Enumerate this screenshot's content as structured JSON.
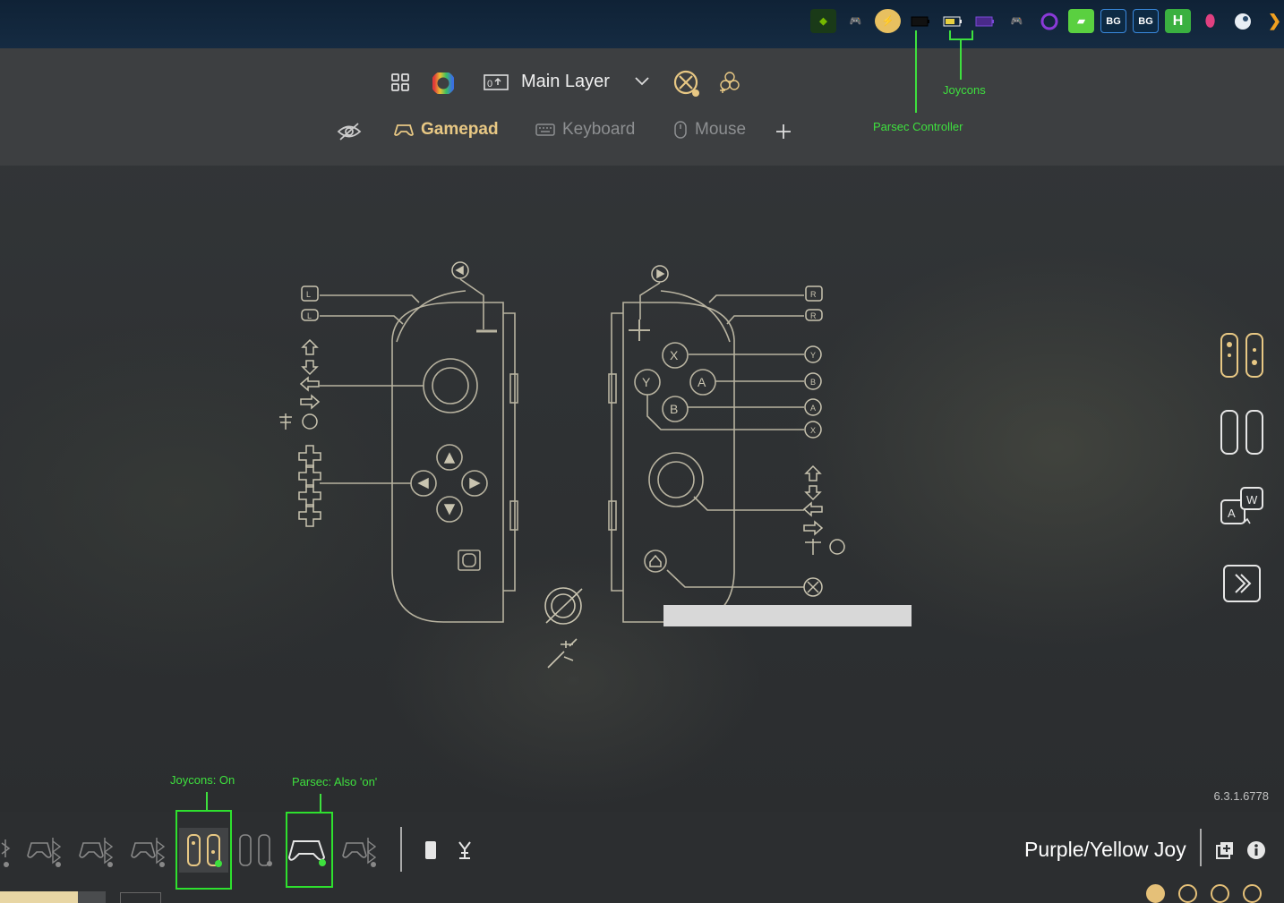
{
  "header": {
    "layer_label": "Main Layer"
  },
  "tabs": [
    {
      "label": "Gamepad",
      "icon": "gamepad-icon",
      "active": true
    },
    {
      "label": "Keyboard",
      "icon": "keyboard-icon",
      "active": false
    },
    {
      "label": "Mouse",
      "icon": "mouse-icon",
      "active": false
    }
  ],
  "annotations": {
    "joycons": "Joycons",
    "parsec_controller": "Parsec Controller",
    "joycons_on": "Joycons: On",
    "parsec_on": "Parsec: Also 'on'"
  },
  "joycon_map": {
    "face_buttons": [
      "X",
      "Y",
      "A",
      "B"
    ],
    "left_shoulder": [
      "L",
      "L"
    ],
    "right_shoulder": [
      "R",
      "R"
    ],
    "mapped_right": [
      "Y",
      "B",
      "A",
      "X"
    ]
  },
  "footer": {
    "version": "6.3.1.6778",
    "profile_name": "Purple/Yellow Joy"
  },
  "tray_icons": [
    "nvidia-icon",
    "gamepad-icon",
    "lightning-icon",
    "battery-icon",
    "battery-yellow-icon",
    "battery-purple-icon",
    "gamepad-icon",
    "ring-icon",
    "green-app-icon",
    "bg-icon",
    "bg-icon",
    "h-icon",
    "shield-icon",
    "steam-icon",
    "chevron-right-icon"
  ],
  "colors": {
    "accent": "#e8c884",
    "annotation": "#3ee03e",
    "taskbar": "#132840"
  }
}
